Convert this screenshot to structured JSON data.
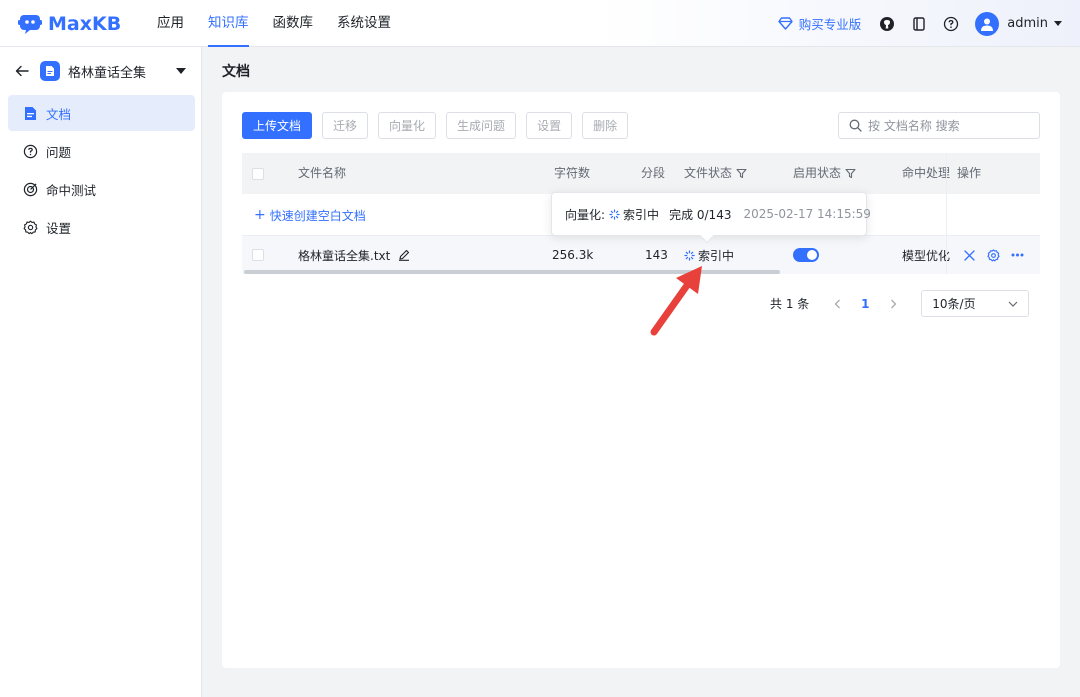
{
  "header": {
    "logo_text": "MaxKB",
    "nav": [
      "应用",
      "知识库",
      "函数库",
      "系统设置"
    ],
    "active_nav": "知识库",
    "buy_label": "购买专业版",
    "user": "admin"
  },
  "sidebar": {
    "kb_name": "格林童话全集",
    "items": [
      {
        "label": "文档",
        "icon": "document-icon",
        "active": true
      },
      {
        "label": "问题",
        "icon": "question-icon",
        "active": false
      },
      {
        "label": "命中测试",
        "icon": "target-icon",
        "active": false
      },
      {
        "label": "设置",
        "icon": "gear-icon",
        "active": false
      }
    ]
  },
  "main": {
    "title": "文档",
    "toolbar": [
      "上传文档",
      "迁移",
      "向量化",
      "生成问题",
      "设置",
      "删除"
    ],
    "search_placeholder": "按 文档名称 搜索",
    "columns": [
      "文件名称",
      "字符数",
      "分段",
      "文件状态",
      "启用状态",
      "命中处理",
      "操作"
    ],
    "quick_create": "快速创建空白文档",
    "rows": [
      {
        "name": "格林童话全集.txt",
        "chars": "256.3k",
        "segments": "143",
        "status": "索引中",
        "enabled": true,
        "hit_handling": "模型优化"
      }
    ],
    "pagination": {
      "total": "共 1 条",
      "current": "1",
      "page_size": "10条/页"
    }
  },
  "tooltip": {
    "label": "向量化:",
    "status": "索引中",
    "done": "完成 0/143",
    "time": "2025-02-17 14:15:59"
  },
  "colors": {
    "accent": "#3370ff",
    "annotation_arrow": "#e8403a"
  }
}
